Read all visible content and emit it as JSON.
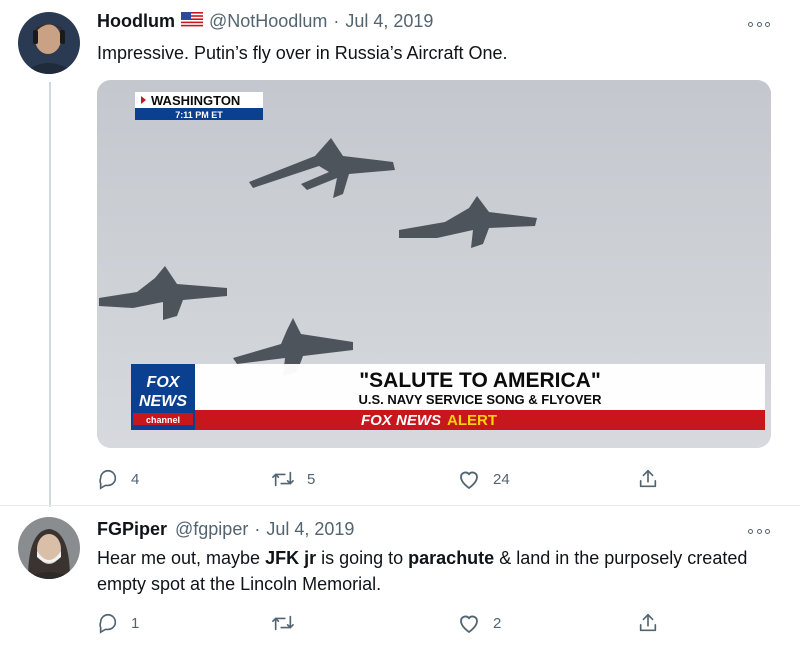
{
  "tweet1": {
    "author": "Hoodlum",
    "handle": "@NotHoodlum",
    "separator": "·",
    "date": "Jul 4, 2019",
    "text": "Impressive. Putin’s fly over in Russia’s Aircraft One.",
    "media": {
      "location_tag": "WASHINGTON",
      "time_tag": "7:11 PM ET",
      "logo_line1": "FOX",
      "logo_line2": "NEWS",
      "logo_line3": "channel",
      "headline": "\"SALUTE TO AMERICA\"",
      "subheadline": "U.S. NAVY SERVICE SONG & FLYOVER",
      "alert_brand": "FOX NEWS",
      "alert_word": "ALERT"
    },
    "stats": {
      "replies": "4",
      "retweets": "5",
      "likes": "24"
    }
  },
  "tweet2": {
    "author": "FGPiper",
    "handle": "@fgpiper",
    "separator": "·",
    "date": "Jul 4, 2019",
    "text_part1": "Hear me out, maybe ",
    "text_bold1": "JFK jr",
    "text_part2": " is going to ",
    "text_bold2": "parachute",
    "text_part3": " & land in the purposely created empty spot at the Lincoln Memorial.",
    "stats": {
      "replies": "1",
      "retweets": "",
      "likes": "2"
    }
  },
  "colors": {
    "text": "#0f1419",
    "muted": "#536471",
    "fox_red": "#c8161d",
    "fox_blue": "#0b3f8f",
    "alert_yellow": "#ffd400",
    "sky": "#cfd3d8"
  },
  "icons": [
    "more-icon",
    "reply-icon",
    "retweet-icon",
    "like-icon",
    "share-icon",
    "us-flag-icon"
  ]
}
